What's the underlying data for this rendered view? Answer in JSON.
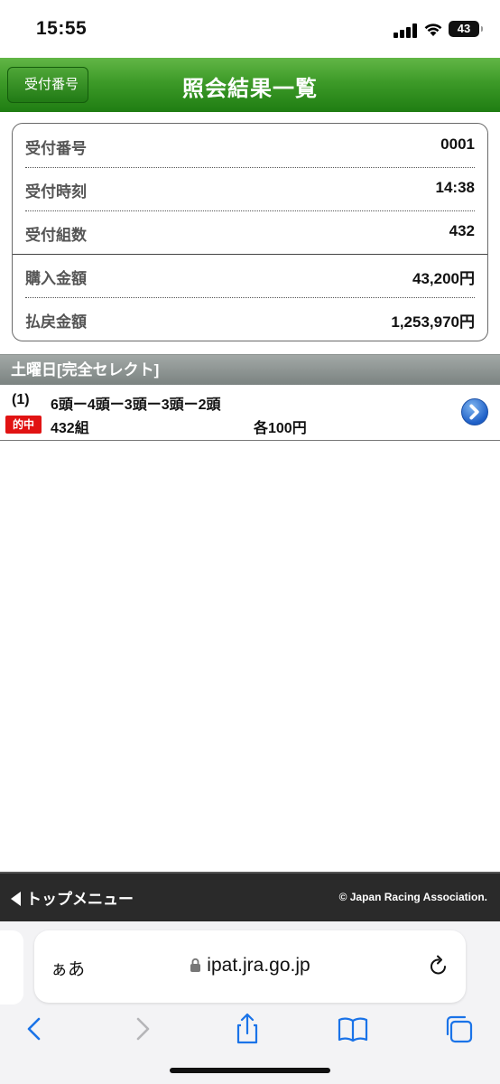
{
  "status_bar": {
    "time": "15:55",
    "battery": "43"
  },
  "header": {
    "back_label": "受付番号",
    "title": "照会結果一覧",
    "color": "#3d9a28"
  },
  "summary": {
    "rows": [
      {
        "label": "受付番号",
        "value": "0001"
      },
      {
        "label": "受付時刻",
        "value": "14:38"
      },
      {
        "label": "受付組数",
        "value": "432"
      },
      {
        "label": "購入金額",
        "value": "43,200円"
      },
      {
        "label": "払戻金額",
        "value": "1,253,970円"
      }
    ]
  },
  "section": {
    "title": "土曜日[完全セレクト]"
  },
  "results": [
    {
      "index": "(1)",
      "combo": "6頭ー4頭ー3頭ー3頭ー2頭",
      "badge": "的中",
      "count": "432組",
      "unit_price": "各100円",
      "badge_color": "#e11313"
    }
  ],
  "footer": {
    "top_menu": "トップメニュー",
    "copyright": "© Japan Racing Association."
  },
  "browser": {
    "aa_label": "ぁあ",
    "url": "ipat.jra.go.jp",
    "accent": "#1a73e8"
  }
}
